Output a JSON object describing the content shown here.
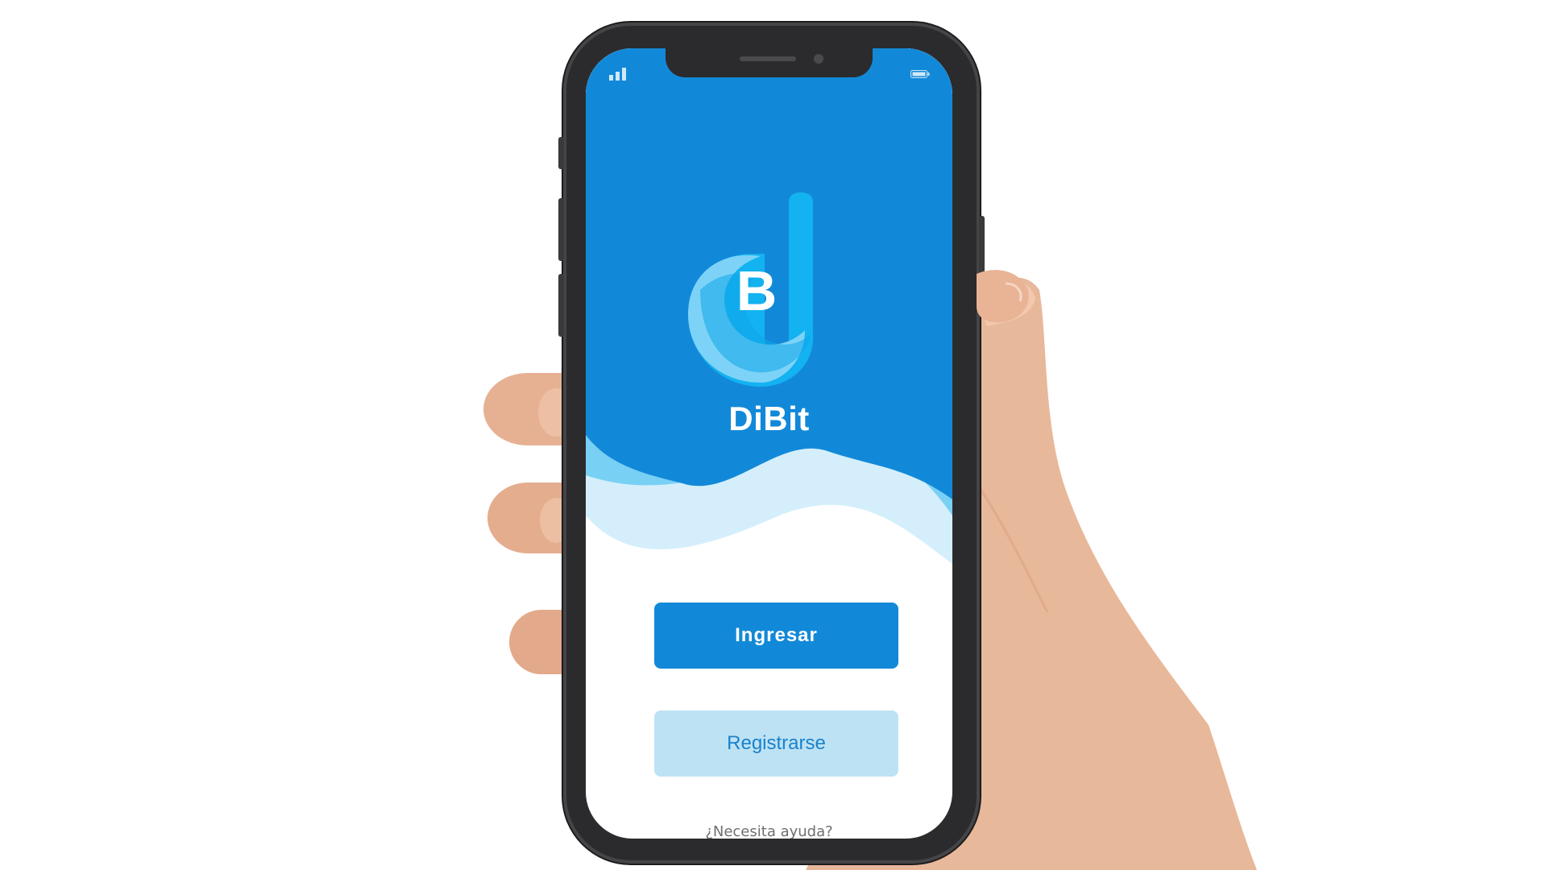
{
  "app": {
    "title": "DiBit",
    "logo_letter": "B"
  },
  "actions": {
    "login_label": "Ingresar",
    "register_label": "Registrarse",
    "help_label": "¿Necesita ayuda?"
  },
  "status_bar": {
    "signal_icon": "signal-bars-icon",
    "battery_icon": "battery-icon"
  },
  "colors": {
    "brand_blue": "#1289d8",
    "light_blue": "#bde2f4",
    "wave_mid": "#79d0f5",
    "wave_light": "#d4effb"
  }
}
